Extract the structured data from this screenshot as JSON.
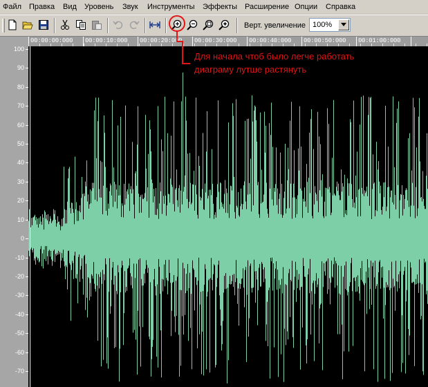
{
  "menu": {
    "items": [
      "Файл",
      "Правка",
      "Вид",
      "Уровень",
      "Звук",
      "Инструменты",
      "Эффекты",
      "Расширение",
      "Опции",
      "Справка"
    ]
  },
  "toolbar": {
    "buttons": [
      {
        "name": "new-file",
        "icon": "new-file-icon"
      },
      {
        "name": "open-file",
        "icon": "folder-open-icon"
      },
      {
        "name": "save-file",
        "icon": "save-icon"
      },
      {
        "name": "cut",
        "icon": "scissors-icon"
      },
      {
        "name": "copy",
        "icon": "copy-icon"
      },
      {
        "name": "paste",
        "icon": "paste-icon"
      },
      {
        "name": "undo",
        "icon": "undo-icon"
      },
      {
        "name": "redo",
        "icon": "redo-icon"
      },
      {
        "name": "fit-to-window",
        "icon": "fit-width-icon"
      },
      {
        "name": "zoom-in",
        "icon": "zoom-in-icon"
      },
      {
        "name": "zoom-out",
        "icon": "zoom-out-icon"
      },
      {
        "name": "zoom-full",
        "icon": "zoom-full-icon"
      },
      {
        "name": "zoom-selection",
        "icon": "zoom-selection-icon"
      }
    ],
    "vertical_zoom_label": "Верт. увеличение",
    "vertical_zoom_value": "100%"
  },
  "timeline": {
    "labels": [
      "00:00:00:000",
      "00:00:10:000",
      "00:00:20:000",
      "00:00:30:000",
      "00:00:40:000",
      "00:00:50:000",
      "00:01:00:000"
    ]
  },
  "amplitude": {
    "labels": [
      "100",
      "90",
      "80",
      "70",
      "60",
      "50",
      "40",
      "30",
      "20",
      "10",
      "0",
      "-10",
      "-20",
      "-30",
      "-40",
      "-50",
      "-60",
      "-70"
    ]
  },
  "waveform": {
    "color": "#7ccfa6",
    "background": "#000000"
  },
  "annotation": {
    "line1": "Для начала чтоб было легче работать",
    "line2": "диаграму лутше растянуть",
    "color": "#e31414"
  }
}
